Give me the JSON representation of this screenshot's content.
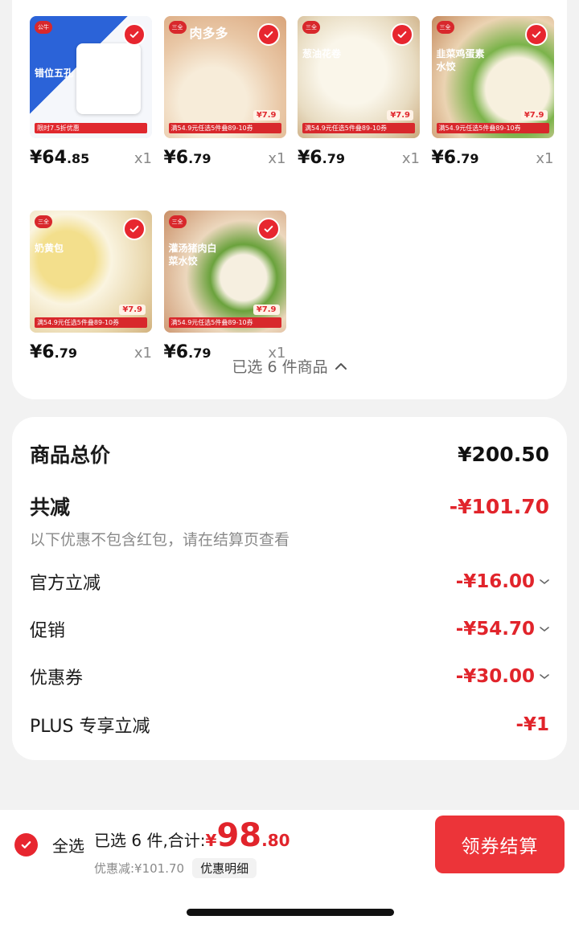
{
  "products": [
    {
      "label": "错位五孔",
      "logo": "公牛",
      "tag": "限时7.5折优惠",
      "price_int": "¥64",
      "price_dec": ".85",
      "qty": "x1",
      "thumb_bg": "#dfe7f3",
      "accent": "#1c5bd6"
    },
    {
      "label": "肉多多",
      "logo": "三全",
      "tag": "满54.9元任选5件叠89-10券",
      "thumb_price": "¥7.9",
      "price_int": "¥6",
      "price_dec": ".79",
      "qty": "x1",
      "thumb_bg": "#f3dcc7",
      "accent": "#e0282e"
    },
    {
      "label": "葱油花卷",
      "logo": "三全",
      "tag": "满54.9元任选5件叠89-10券",
      "thumb_price": "¥7.9",
      "price_int": "¥6",
      "price_dec": ".79",
      "qty": "x1",
      "thumb_bg": "#efe7d6",
      "accent": "#e0282e"
    },
    {
      "label": "韭菜鸡蛋素水饺",
      "logo": "三全",
      "tag": "满54.9元任选5件叠89-10券",
      "thumb_price": "¥7.9",
      "price_int": "¥6",
      "price_dec": ".79",
      "qty": "x1",
      "thumb_bg": "#f2e4cf",
      "accent": "#e0282e"
    },
    {
      "label": "奶黄包",
      "logo": "三全",
      "tag": "满54.9元任选5件叠89-10券",
      "thumb_price": "¥7.9",
      "price_int": "¥6",
      "price_dec": ".79",
      "qty": "x1",
      "thumb_bg": "#f4e9c8",
      "accent": "#e0282e"
    },
    {
      "label": "灌汤猪肉白菜水饺",
      "logo": "三全",
      "tag": "满54.9元任选5件叠89-10券",
      "thumb_price": "¥7.9",
      "price_int": "¥6",
      "price_dec": ".79",
      "qty": "x1",
      "thumb_bg": "#f1dcc8",
      "accent": "#e0282e"
    }
  ],
  "selected_toggle": "已选 6 件商品",
  "summary": {
    "total_label": "商品总价",
    "total_value": "¥200.50",
    "reduce_label": "共减",
    "reduce_value": "-¥101.70",
    "note": "以下优惠不包含红包，请在结算页查看",
    "items": [
      {
        "label": "官方立减",
        "value": "-¥16.00"
      },
      {
        "label": "促销",
        "value": "-¥54.70"
      },
      {
        "label": "优惠券",
        "value": "-¥30.00"
      },
      {
        "label": "PLUS 专享立减",
        "value": "-¥1"
      }
    ]
  },
  "bottom": {
    "select_all": "全选",
    "selected_prefix": "已选 6 件,合计:",
    "currency": "¥",
    "total_int": "98",
    "total_dec": ".80",
    "discount_text": "优惠减:¥101.70",
    "discount_detail": "优惠明细",
    "checkout": "领券结算"
  },
  "colors": {
    "accent": "#e7262f",
    "button": "#ec3439"
  }
}
